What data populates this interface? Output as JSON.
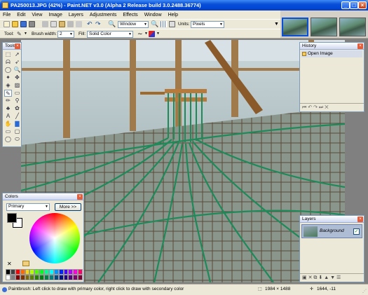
{
  "window": {
    "title": "PA250013.JPG (42%) - Paint.NET v3.0 (Alpha 2 Release build 3.0.2488.36774)"
  },
  "menu": [
    "File",
    "Edit",
    "View",
    "Image",
    "Layers",
    "Adjustments",
    "Effects",
    "Window",
    "Help"
  ],
  "toolbar": {
    "zoom_value": "Window",
    "units_label": "Units:",
    "units_value": "Pixels"
  },
  "tool_options": {
    "tool_label": "Tool:",
    "brush_width_label": "Brush width:",
    "brush_width_value": "2",
    "fill_label": "Fill:",
    "fill_value": "Solid Color"
  },
  "panels": {
    "tools_title": "Tools",
    "history_title": "History",
    "history_items": [
      "Open Image"
    ],
    "colors_title": "Colors",
    "colors_mode": "Primary",
    "more_button": "More >>",
    "layers_title": "Layers",
    "layer_name": "Background"
  },
  "status": {
    "hint": "Paintbrush: Left click to draw with primary color, right click to draw with secondary color",
    "image_size": "1984 × 1488",
    "cursor": "1644, -11"
  },
  "colors": {
    "primary": "#000000",
    "secondary": "#ffffff",
    "accent": "#0a4fd6"
  },
  "palette": [
    "#000000",
    "#404040",
    "#ff0000",
    "#ff6a00",
    "#ffd800",
    "#b6ff00",
    "#4cff00",
    "#00ff21",
    "#00ff90",
    "#00ffff",
    "#0094ff",
    "#0026ff",
    "#4800ff",
    "#b200ff",
    "#ff00dc",
    "#ff006e",
    "#ffffff",
    "#808080",
    "#7f0000",
    "#7f3300",
    "#7f6a00",
    "#5b7f00",
    "#267f00",
    "#007f0e",
    "#007f46",
    "#007f7f",
    "#004a7f",
    "#00137f",
    "#21007f",
    "#57007f",
    "#7f006e",
    "#7f0037"
  ]
}
